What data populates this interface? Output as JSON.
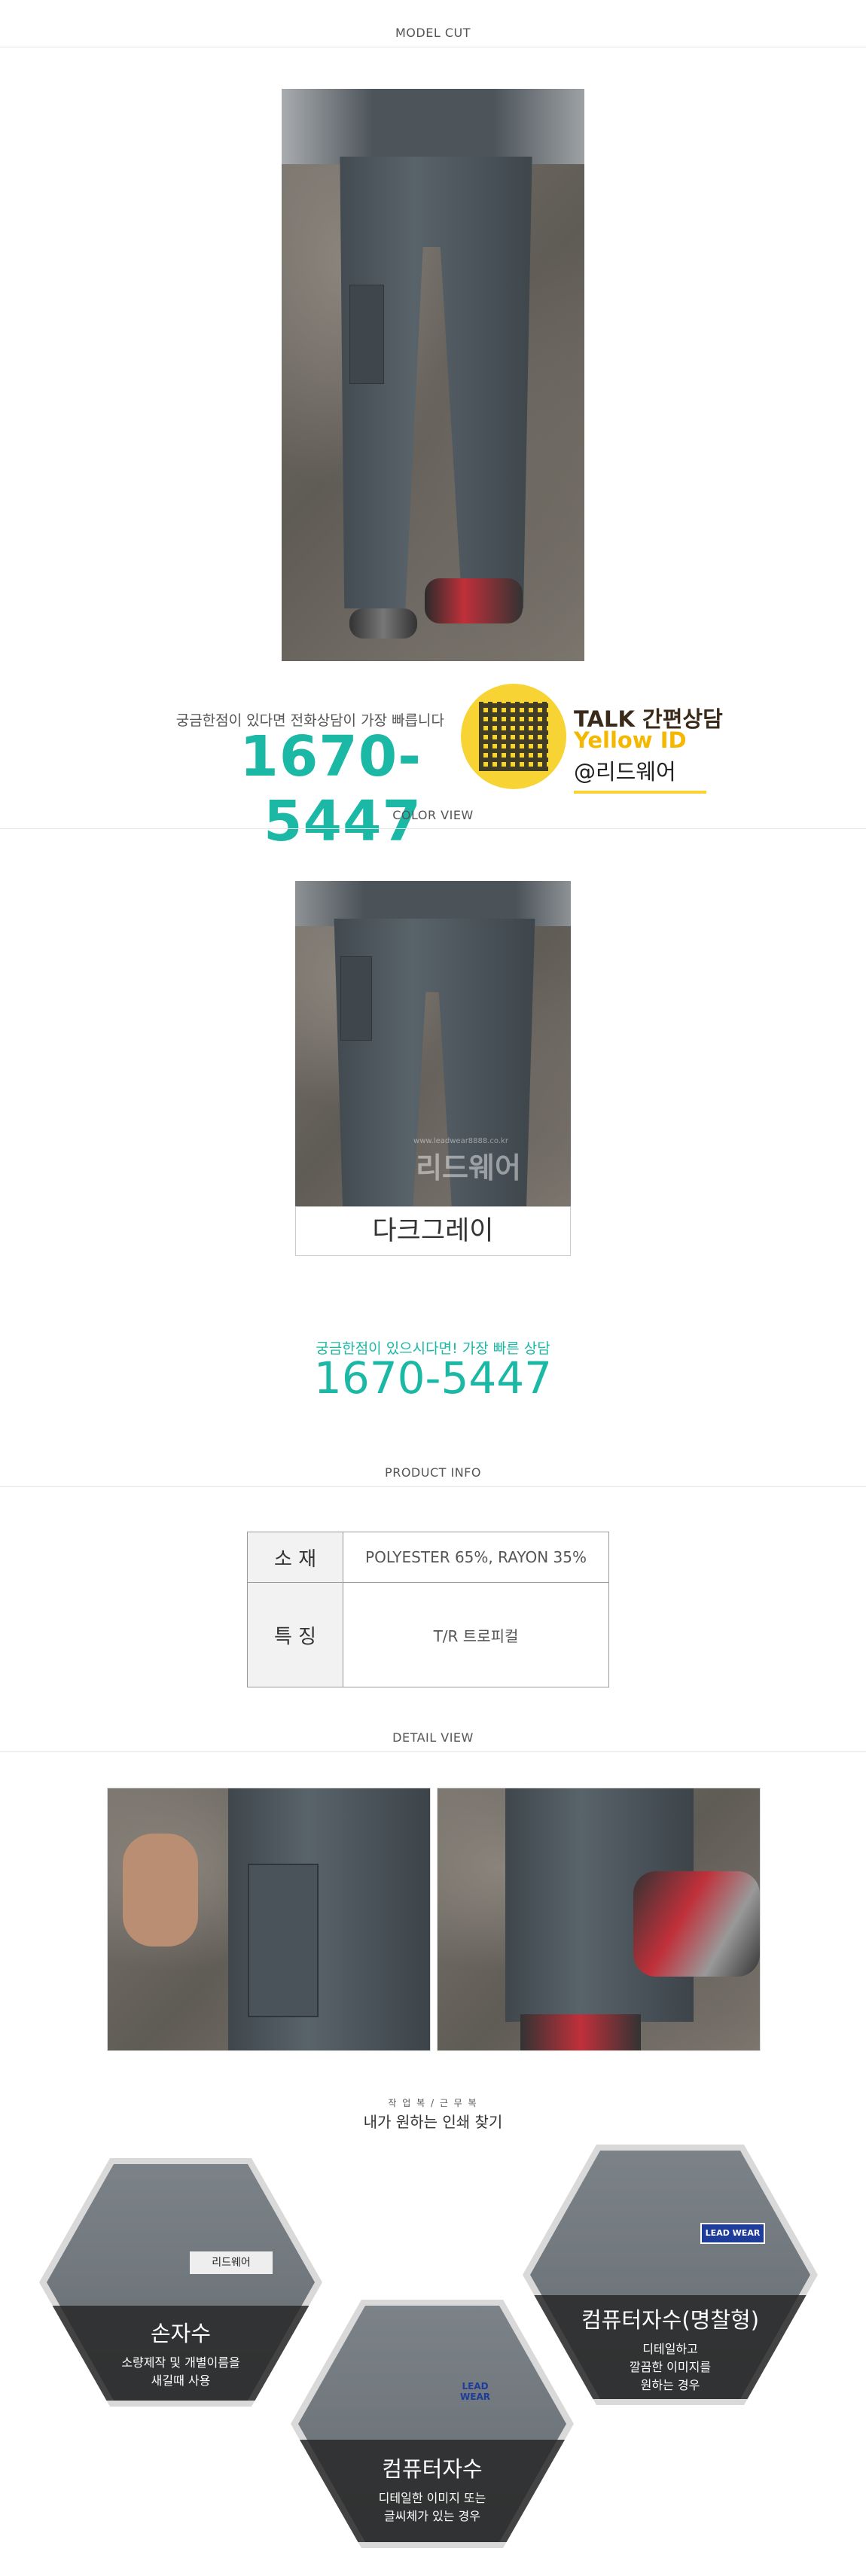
{
  "sections": {
    "model_cut": "MODEL CUT",
    "color_view": "COLOR VIEW",
    "product_info": "PRODUCT INFO",
    "detail_view": "DETAIL VIEW"
  },
  "contact": {
    "question": "궁금한점이 있다면 전화상담이 가장 빠릅니다",
    "phone": "1670-5447",
    "talk": "TALK",
    "talk_sub": "간편상담",
    "yellow_id": "Yellow ID",
    "at_id": "@리드웨어"
  },
  "color_card": {
    "watermark": "리드웨어",
    "watermark_url": "www.leadwear8888.co.kr",
    "name": "다크그레이"
  },
  "contact2": {
    "question": "궁금한점이 있으시다면! 가장 빠른 상담",
    "phone": "1670-5447"
  },
  "product_info": {
    "rows": [
      {
        "label": "소 재",
        "value": "POLYESTER 65%, RAYON 35%"
      },
      {
        "label": "특 징",
        "value": "T/R 트로피컬"
      }
    ]
  },
  "print_guide": {
    "small": "작 업 복 / 근 무 복",
    "title": "내가 원하는 인쇄 찾기",
    "items": [
      {
        "title": "손자수",
        "desc1": "소량제작 및 개별이름을",
        "desc2": "새길때 사용",
        "badge": "리드웨어"
      },
      {
        "title": "컴퓨터자수",
        "desc1": "디테일한 이미지 또는",
        "desc2": "글씨체가 있는 경우",
        "badge": "LEAD WEAR"
      },
      {
        "title": "컴퓨터자수(명찰형)",
        "desc1": "디테일하고",
        "desc2": "깔끔한 이미지를",
        "desc3": "원하는 경우",
        "badge": "LEAD WEAR"
      }
    ]
  },
  "colors": {
    "accent": "#1bb9a5",
    "pants": "#4e575d",
    "kakao": "#f7d433"
  }
}
